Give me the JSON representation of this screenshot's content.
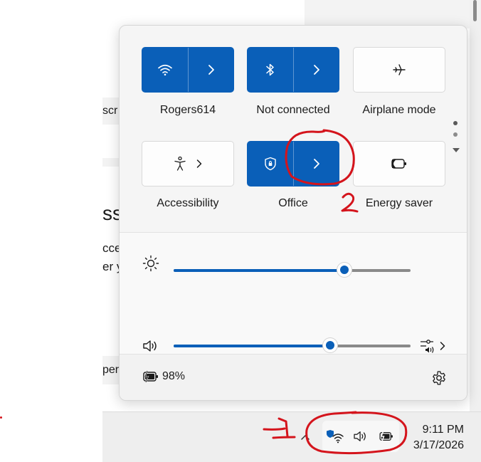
{
  "background": {
    "fragments": [
      "scr",
      "ss",
      "cce",
      "er y",
      "per"
    ]
  },
  "quick_settings": {
    "tiles": [
      {
        "label": "Rogers614",
        "icon": "wifi-icon",
        "state": "on",
        "split": true
      },
      {
        "label": "Not connected",
        "icon": "bluetooth-icon",
        "state": "on",
        "split": true
      },
      {
        "label": "Airplane mode",
        "icon": "airplane-icon",
        "state": "off",
        "split": false
      },
      {
        "label": "Accessibility",
        "icon": "accessibility-icon",
        "state": "off",
        "split": false,
        "chevron": true
      },
      {
        "label": "Office",
        "icon": "vpn-shield-icon",
        "state": "on",
        "split": true
      },
      {
        "label": "Energy saver",
        "icon": "energy-saver-icon",
        "state": "off",
        "split": false
      }
    ],
    "brightness": {
      "icon": "brightness-icon",
      "value": 0.72
    },
    "volume": {
      "icon": "speaker-icon",
      "value": 0.66,
      "mixer_icon": "audio-output-icon"
    },
    "battery": {
      "icon": "battery-charging-icon",
      "percent": "98%"
    },
    "settings_icon": "gear-icon"
  },
  "taskbar": {
    "time": "9:11 PM",
    "date": "3/17/2026",
    "tray_icons": [
      "network-shield-icon",
      "speaker-icon",
      "battery-charging-icon"
    ]
  },
  "annotations": {
    "step1": "1",
    "step2": "2",
    "color": "#d4141c"
  },
  "colors": {
    "accent": "#0a5fb8",
    "panel_bg": "#f5f5f5",
    "annotation_red": "#d4141c"
  }
}
